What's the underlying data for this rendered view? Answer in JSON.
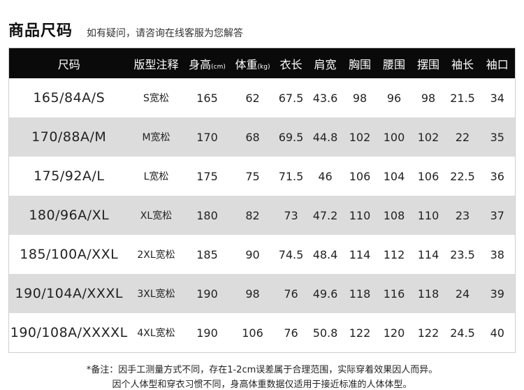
{
  "header": {
    "title": "商品尺码",
    "subtitle": "如有疑问，请咨询在线客服为您解答"
  },
  "table": {
    "columns": [
      {
        "label": "尺码",
        "unit": ""
      },
      {
        "label": "版型注释",
        "unit": ""
      },
      {
        "label": "身高",
        "unit": "(cm)"
      },
      {
        "label": "体重",
        "unit": "(kg)"
      },
      {
        "label": "衣长",
        "unit": ""
      },
      {
        "label": "肩宽",
        "unit": ""
      },
      {
        "label": "胸围",
        "unit": ""
      },
      {
        "label": "腰围",
        "unit": ""
      },
      {
        "label": "摆围",
        "unit": ""
      },
      {
        "label": "袖长",
        "unit": ""
      },
      {
        "label": "袖口",
        "unit": ""
      }
    ],
    "rows": [
      [
        "165/84A/S",
        "S宽松",
        "165",
        "62",
        "67.5",
        "43.6",
        "98",
        "96",
        "98",
        "21.5",
        "34"
      ],
      [
        "170/88A/M",
        "M宽松",
        "170",
        "68",
        "69.5",
        "44.8",
        "102",
        "100",
        "102",
        "22",
        "35"
      ],
      [
        "175/92A/L",
        "L宽松",
        "175",
        "75",
        "71.5",
        "46",
        "106",
        "104",
        "106",
        "22.5",
        "36"
      ],
      [
        "180/96A/XL",
        "XL宽松",
        "180",
        "82",
        "73",
        "47.2",
        "110",
        "108",
        "110",
        "23",
        "37"
      ],
      [
        "185/100A/XXL",
        "2XL宽松",
        "185",
        "90",
        "74.5",
        "48.4",
        "114",
        "112",
        "114",
        "23.5",
        "38"
      ],
      [
        "190/104A/XXXL",
        "3XL宽松",
        "190",
        "98",
        "76",
        "49.6",
        "118",
        "116",
        "118",
        "24",
        "39"
      ],
      [
        "190/108A/XXXXL",
        "4XL宽松",
        "190",
        "106",
        "76",
        "50.8",
        "122",
        "120",
        "122",
        "24.5",
        "40"
      ]
    ]
  },
  "notes": {
    "line1": "*备注：因手工测量方式不同，存在1-2cm误差属于合理范围，实际穿着效果因人而异。",
    "line2": "因个人体型和穿衣习惯不同，身高体重数据仅适用于接近标准的人体体型。"
  }
}
